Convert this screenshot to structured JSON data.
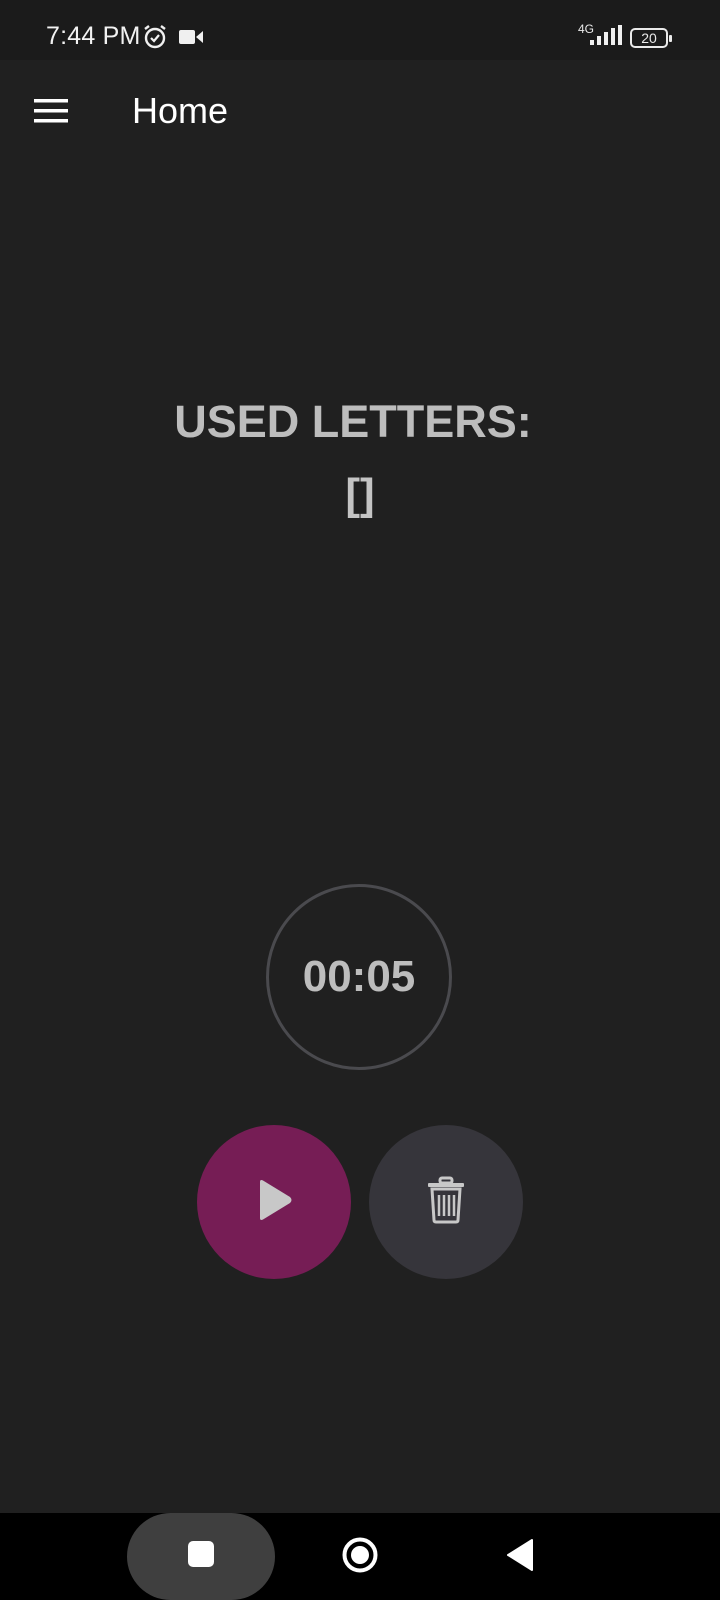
{
  "status_bar": {
    "time": "7:44 PM",
    "network_label": "4G",
    "battery_level": "20",
    "icons": [
      "alarm-icon",
      "video-camera-icon",
      "signal-icon",
      "battery-icon"
    ]
  },
  "app_bar": {
    "title": "Home",
    "menu_icon": "hamburger-menu-icon"
  },
  "main": {
    "used_letters_label": "USED LETTERS:",
    "used_letters_value": "[]",
    "timer": "00:05"
  },
  "actions": {
    "play_icon": "play-icon",
    "delete_icon": "trash-icon"
  },
  "nav_bar": {
    "icons": [
      "recents-square-icon",
      "home-circle-icon",
      "back-triangle-icon"
    ]
  },
  "colors": {
    "background": "#202020",
    "play_button": "#761d55",
    "delete_button": "#36353b",
    "timer_ring": "#4a4a4e",
    "text_muted": "#bdbdbd"
  }
}
